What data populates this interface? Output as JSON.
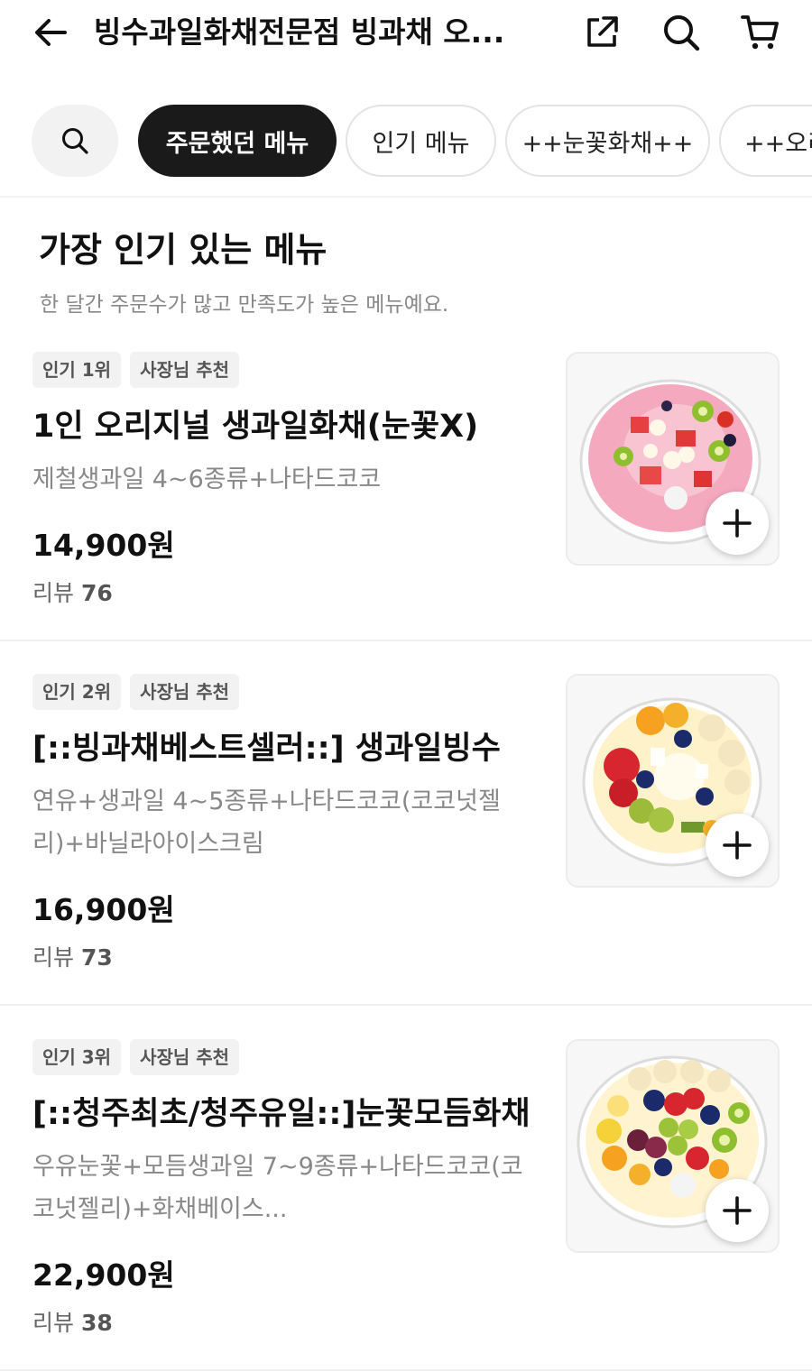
{
  "header": {
    "title": "빙수과일화채전문점 빙과채 오...",
    "back_icon": "arrow-left-icon",
    "share_icon": "share-external-icon",
    "search_icon": "search-icon",
    "cart_icon": "cart-icon"
  },
  "categories": {
    "search_icon": "search-icon",
    "chips": [
      {
        "label": "주문했던 메뉴",
        "active": true
      },
      {
        "label": "인기 메뉴",
        "active": false
      },
      {
        "label": "++눈꽃화채++",
        "active": false
      },
      {
        "label": "++오리",
        "active": false
      }
    ]
  },
  "section": {
    "title": "가장 인기 있는 메뉴",
    "subtitle": "한 달간 주문수가 많고 만족도가 높은 메뉴예요."
  },
  "menu_items": [
    {
      "rank_badge": "인기 1위",
      "owner_badge": "사장님 추천",
      "name": "1인 오리지널 생과일화채(눈꽃X)",
      "description": "제철생과일 4~6종류+나타드코코",
      "price": "14,900원",
      "review_label": "리뷰",
      "review_count": "76",
      "image": "strawberry-milk-fruit-punch-bowl"
    },
    {
      "rank_badge": "인기 2위",
      "owner_badge": "사장님 추천",
      "name": "[::빙과채베스트셀러::] 생과일빙수",
      "description": "연유+생과일 4~5종류+나타드코코(코코넛젤리)+바닐라아이스크림",
      "price": "16,900원",
      "review_label": "리뷰",
      "review_count": "73",
      "image": "fruit-bingsu-bowl"
    },
    {
      "rank_badge": "인기 3위",
      "owner_badge": "사장님 추천",
      "name": "[::청주최초/청주유일::]눈꽃모듬화채",
      "description": "우유눈꽃+모듬생과일 7~9종류+나타드코코(코코넛젤리)+화채베이스...",
      "price": "22,900원",
      "review_label": "리뷰",
      "review_count": "38",
      "image": "mixed-fruit-snowflake-bowl"
    }
  ],
  "add_button_icon": "plus-icon"
}
